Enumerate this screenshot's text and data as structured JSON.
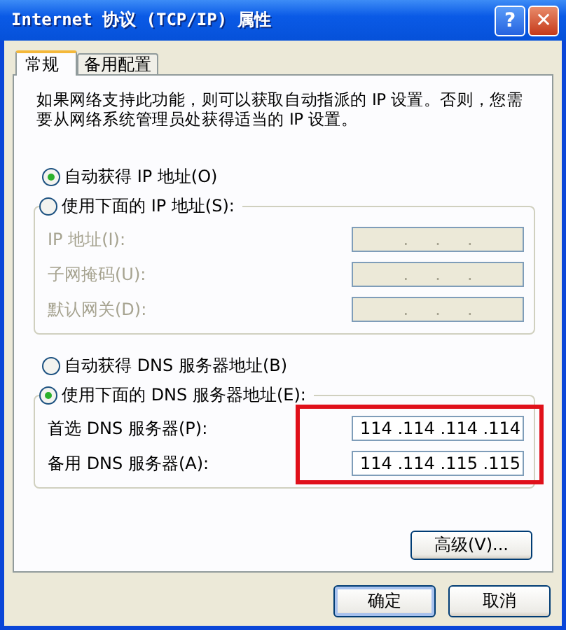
{
  "window": {
    "title": "Internet 协议 (TCP/IP) 属性",
    "buttons": [
      {
        "kind": "help",
        "label": "?"
      },
      {
        "kind": "close",
        "label": "✕"
      }
    ]
  },
  "tabs": [
    {
      "label": "常规",
      "selected": true
    },
    {
      "label": "备用配置",
      "selected": false
    }
  ],
  "intro": "如果网络支持此功能，则可以获取自动指派的 IP 设置。否则，您需要从网络系统管理员处获得适当的 IP 设置。",
  "ip_section": {
    "options": [
      {
        "label": "自动获得 IP 地址(O)",
        "selected": true
      },
      {
        "label": "使用下面的 IP 地址(S):",
        "selected": false
      }
    ],
    "fields": [
      {
        "label": "IP 地址(I):",
        "value": ".     .     .",
        "disabled": true
      },
      {
        "label": "子网掩码(U):",
        "value": ".     .     .",
        "disabled": true
      },
      {
        "label": "默认网关(D):",
        "value": ".     .     .",
        "disabled": true
      }
    ]
  },
  "dns_section": {
    "options": [
      {
        "label": "自动获得 DNS 服务器地址(B)",
        "selected": false
      },
      {
        "label": "使用下面的 DNS 服务器地址(E):",
        "selected": true
      }
    ],
    "highlighted": true,
    "fields": [
      {
        "label": "首选 DNS 服务器(P):",
        "value": "114 .114 .114 .114",
        "disabled": false
      },
      {
        "label": "备用 DNS 服务器(A):",
        "value": "114 .114 .115 .115",
        "disabled": false
      }
    ]
  },
  "advanced_button": "高级(V)...",
  "buttons": [
    "确定",
    "取消"
  ]
}
